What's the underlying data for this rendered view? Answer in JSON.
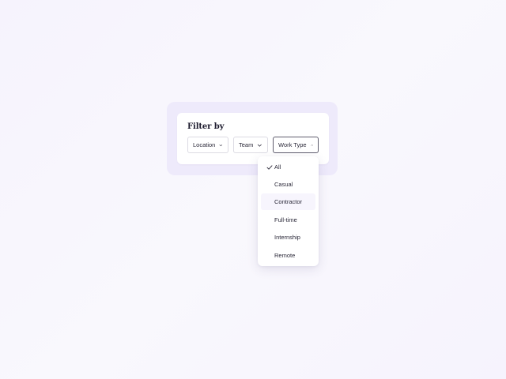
{
  "filter": {
    "title": "Filter by",
    "buttons": [
      {
        "label": "Location",
        "chevron": "chevron-down-icon"
      },
      {
        "label": "Team",
        "chevron": "chevron-down-icon"
      },
      {
        "label": "Work Type",
        "chevron": "chevron-up-icon"
      }
    ]
  },
  "dropdown": {
    "selected": "All",
    "hovered": "Contractor",
    "items": [
      {
        "label": "All"
      },
      {
        "label": "Casual"
      },
      {
        "label": "Contractor"
      },
      {
        "label": "Full-time"
      },
      {
        "label": "Internship"
      },
      {
        "label": "Remote"
      }
    ]
  },
  "colors": {
    "background": "#f7f4fd",
    "panel": "#eeeafb",
    "text": "#2a2838",
    "border": "#dcdbe3",
    "active_border": "#5f5d6e",
    "hover": "#f7f5fd"
  }
}
